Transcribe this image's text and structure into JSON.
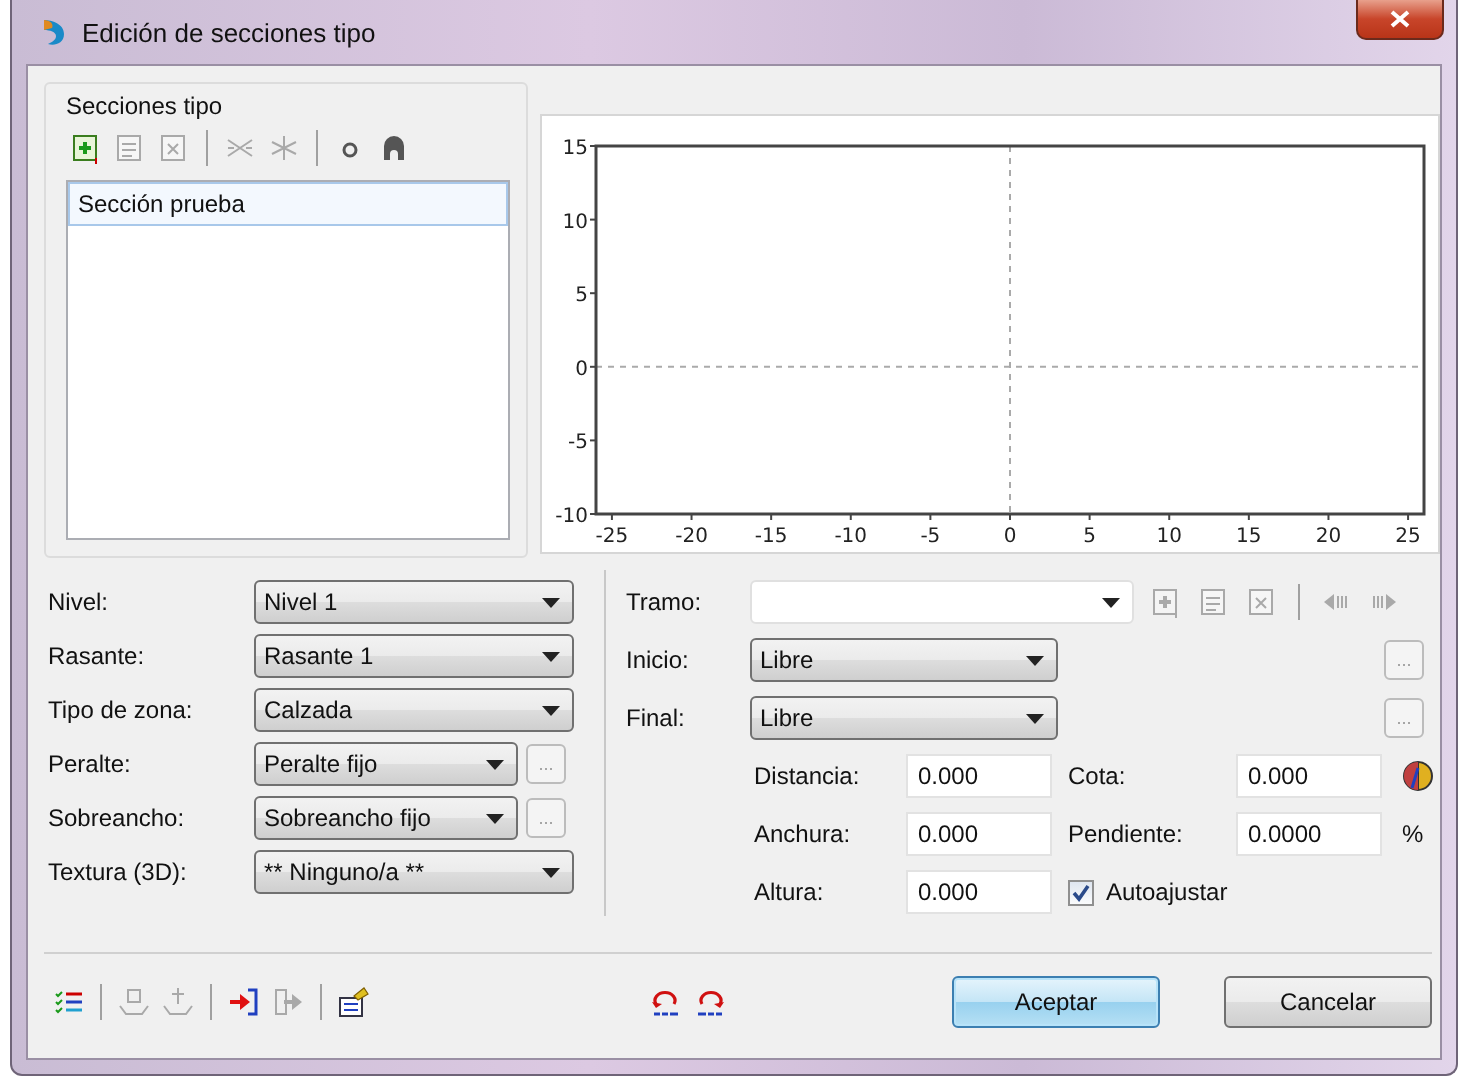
{
  "window": {
    "title": "Edición de secciones tipo"
  },
  "sections": {
    "title": "Secciones tipo",
    "toolbar": [
      {
        "kind": "add",
        "disabled": false
      },
      {
        "kind": "edit",
        "disabled": true
      },
      {
        "kind": "delete",
        "disabled": true
      },
      {
        "kind": "separator"
      },
      {
        "kind": "swap",
        "disabled": true
      },
      {
        "kind": "star",
        "disabled": true
      },
      {
        "kind": "separator"
      },
      {
        "kind": "dot",
        "disabled": false
      },
      {
        "kind": "ring",
        "disabled": false
      }
    ],
    "items": [
      {
        "label": "Sección prueba",
        "selected": true
      }
    ]
  },
  "chart": {
    "chart_data": {
      "type": "line",
      "xlim": [
        -26,
        26
      ],
      "ylim": [
        -10,
        15
      ],
      "xticks": [
        -25,
        -20,
        -15,
        -10,
        -5,
        0,
        5,
        10,
        15,
        20,
        25
      ],
      "yticks": [
        -10,
        -5,
        0,
        5,
        10,
        15
      ]
    }
  },
  "properties": [
    {
      "label": "Nivel:",
      "value": "Nivel 1"
    },
    {
      "label": "Rasante:",
      "value": "Rasante 1"
    },
    {
      "label": "Tipo de zona:",
      "value": "Calzada"
    },
    {
      "label": "Peralte:",
      "value": "Peralte fijo",
      "button": {
        "label": "...",
        "disabled": true
      }
    },
    {
      "label": "Sobreancho:",
      "value": "Sobreancho fijo",
      "button": {
        "label": "...",
        "disabled": true
      }
    },
    {
      "label": "Textura (3D):",
      "value": "** Ninguno/a **"
    }
  ],
  "tramo": {
    "label": "Tramo:",
    "toolbar": [
      {
        "kind": "add",
        "disabled": true
      },
      {
        "kind": "edit",
        "disabled": true
      },
      {
        "kind": "delete",
        "disabled": true
      },
      {
        "kind": "separator"
      },
      {
        "kind": "prev",
        "disabled": true
      },
      {
        "kind": "next",
        "disabled": true
      }
    ]
  },
  "ends": [
    {
      "label": "Inicio:",
      "value": "Libre",
      "button": {
        "label": "...",
        "disabled": true
      }
    },
    {
      "label": "Final:",
      "value": "Libre",
      "button": {
        "label": "...",
        "disabled": true
      }
    }
  ],
  "geometry": [
    {
      "fields": [
        {
          "label": "Distancia:",
          "value": "0.000"
        },
        {
          "label": "Cota:",
          "value": "0.000"
        }
      ],
      "trailing": {
        "kind": "icon"
      }
    },
    {
      "fields": [
        {
          "label": "Anchura:",
          "value": "0.000"
        },
        {
          "label": "Pendiente:",
          "value": "0.0000"
        }
      ],
      "trailing": {
        "kind": "text",
        "text": "%"
      }
    },
    {
      "fields": [
        {
          "label": "Altura:",
          "value": "0.000"
        }
      ],
      "trailing": {
        "kind": "checkbox",
        "label": "Autoajustar",
        "checked": true
      }
    }
  ],
  "bottom_toolbar": [
    {
      "kind": "list",
      "disabled": false
    },
    {
      "kind": "separator"
    },
    {
      "kind": "insert-top",
      "disabled": true
    },
    {
      "kind": "insert-axis",
      "disabled": true
    },
    {
      "kind": "separator"
    },
    {
      "kind": "import",
      "disabled": false
    },
    {
      "kind": "export",
      "disabled": true
    },
    {
      "kind": "separator"
    },
    {
      "kind": "properties",
      "disabled": false
    }
  ],
  "history_toolbar": [
    {
      "kind": "undo",
      "disabled": false
    },
    {
      "kind": "redo",
      "disabled": false
    }
  ],
  "buttons": [
    {
      "label": "Aceptar",
      "default": true
    },
    {
      "label": "Cancelar",
      "default": false
    }
  ]
}
